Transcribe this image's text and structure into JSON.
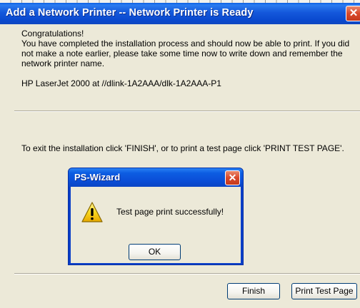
{
  "window": {
    "title": "Add a Network Printer -- Network Printer is Ready",
    "close_glyph": "✕"
  },
  "content": {
    "congrats": "Congratulations!",
    "message": "You have completed the installation process and should now be able to print. If you did not make a note earlier, please take some time now to write down and remember the network printer name.",
    "printer_name": "HP LaserJet 2000 at //dlink-1A2AAA/dlk-1A2AAA-P1",
    "exit_instructions": "To exit the installation click 'FINISH', or to print a test page click 'PRINT TEST PAGE'."
  },
  "buttons": {
    "finish": "Finish",
    "print_test_page": "Print Test Page"
  },
  "dialog": {
    "title": "PS-Wizard",
    "message": "Test page print successfully!",
    "ok": "OK",
    "icon": "warning-icon",
    "close_glyph": "✕"
  },
  "colors": {
    "titlebar": "#0a49cf",
    "close": "#d9482a",
    "face": "#ece9d8"
  }
}
